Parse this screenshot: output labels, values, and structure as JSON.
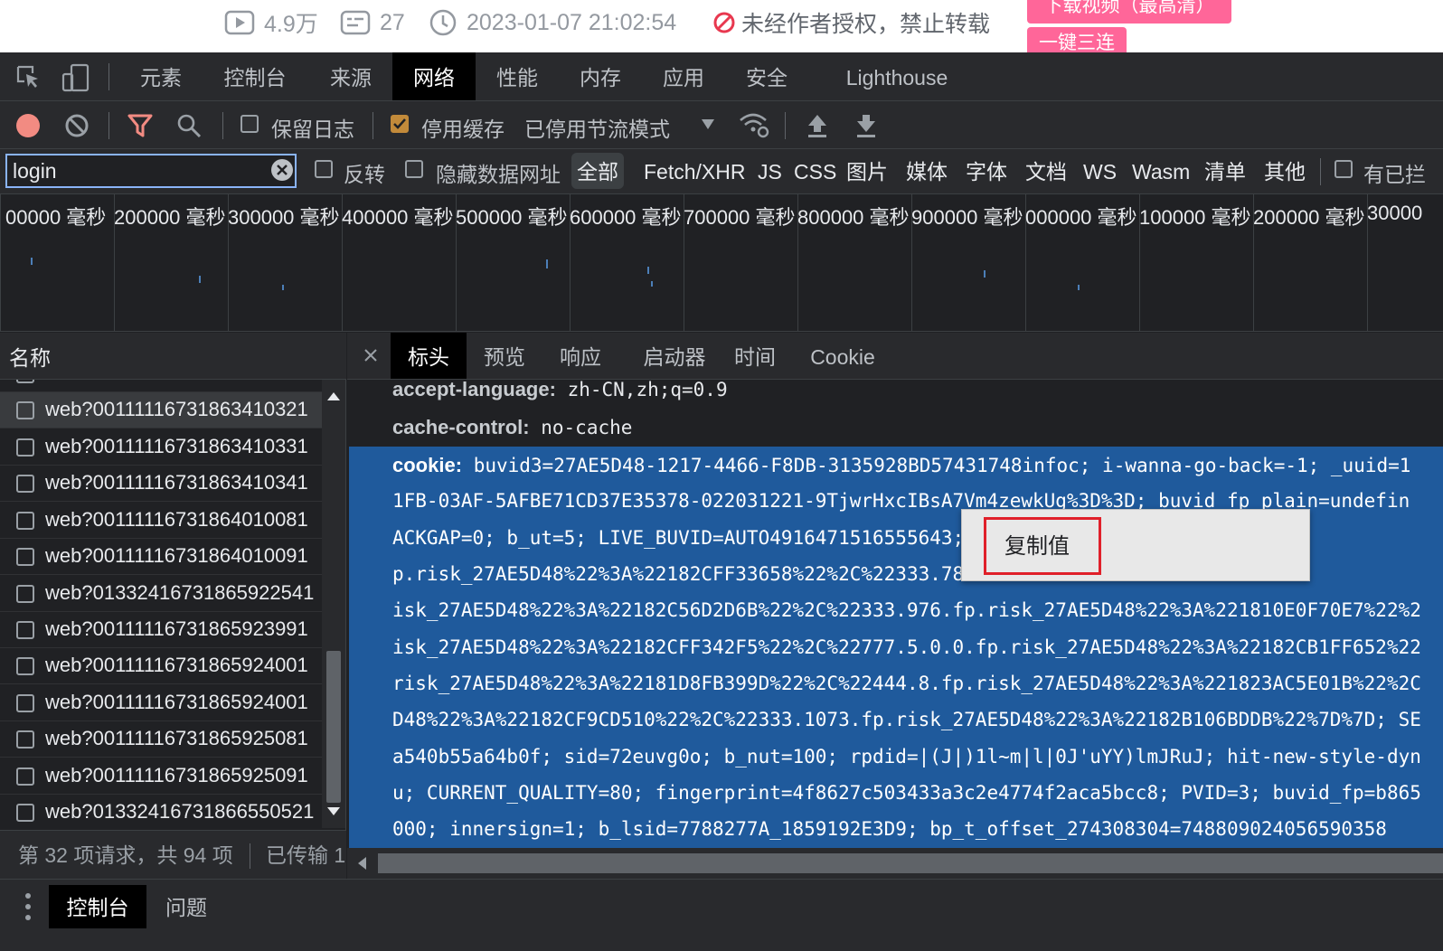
{
  "video_info": {
    "views": "4.9万",
    "danmaku": "27",
    "published": "2023-01-07 21:02:54",
    "notice": "未经作者授权，禁止转载",
    "download_label": "下载视频（最高清）",
    "triple_label": "一键三连"
  },
  "panel_tabs": [
    "元素",
    "控制台",
    "来源",
    "网络",
    "性能",
    "内存",
    "应用",
    "安全",
    "Lighthouse"
  ],
  "active_panel": "网络",
  "toolbar": {
    "preserve_log": "保留日志",
    "disable_cache": "停用缓存",
    "throttling": "已停用节流模式"
  },
  "filter": {
    "value": "login",
    "invert": "反转",
    "hide_data_urls": "隐藏数据网址",
    "types": [
      "全部",
      "Fetch/XHR",
      "JS",
      "CSS",
      "图片",
      "媒体",
      "字体",
      "文档",
      "WS",
      "Wasm",
      "清单",
      "其他"
    ],
    "blocked_cookies": "有已拦"
  },
  "timeline_ticks": [
    "00000 毫秒",
    "200000 毫秒",
    "300000 毫秒",
    "400000 毫秒",
    "500000 毫秒",
    "600000 毫秒",
    "700000 毫秒",
    "800000 毫秒",
    "900000 毫秒",
    "000000 毫秒",
    "100000 毫秒",
    "200000 毫秒",
    "30000"
  ],
  "request_list": {
    "header": "名称",
    "rows": [
      "web?00111116731863410321",
      "web?00111116731863410331",
      "web?00111116731863410341",
      "web?00111116731864010081",
      "web?00111116731864010091",
      "web?01332416731865922541",
      "web?00111116731865923991",
      "web?00111116731865924001",
      "web?00111116731865924001",
      "web?00111116731865925081",
      "web?00111116731865925091",
      "web?01332416731866550521"
    ],
    "status": "第 32 项请求，共 94 项",
    "transferred": "已传输 1"
  },
  "detail_tabs": [
    "标头",
    "预览",
    "响应",
    "启动器",
    "时间",
    "Cookie"
  ],
  "active_detail_tab": "标头",
  "headers": [
    {
      "key": "accept-language:",
      "value": "zh-CN,zh;q=0.9"
    },
    {
      "key": "cache-control:",
      "value": "no-cache"
    }
  ],
  "cookie": {
    "key": "cookie:",
    "lines": [
      "buvid3=27AE5D48-1217-4466-F8DB-3135928BD57431748infoc; i-wanna-go-back=-1; _uuid=1",
      "1FB-03AF-5AFBE71CD37E35378-022031221-9TjwrHxcIBsA7Vm4zewkUg%3D%3D; buvid_fp_plain=undefin",
      "ACKGAP=0; b_ut=5; LIVE_BUVID=AUTO4916471516555643;                                 =1; black",
      "p.risk_27AE5D48%22%3A%22182CFF33658%22%2C%22333.78                                 CFF3518B%2",
      "isk_27AE5D48%22%3A%22182C56D2D6B%22%2C%22333.976.fp.risk_27AE5D48%22%3A%221810E0F70E7%22%2",
      "isk_27AE5D48%22%3A%22182CFF342F5%22%2C%22777.5.0.0.fp.risk_27AE5D48%22%3A%22182CB1FF652%22",
      "risk_27AE5D48%22%3A%22181D8FB399D%22%2C%22444.8.fp.risk_27AE5D48%22%3A%221823AC5E01B%22%2C",
      "D48%22%3A%22182CF9CD510%22%2C%22333.1073.fp.risk_27AE5D48%22%3A%22182B106BDDB%22%7D%7D; SE",
      "a540b55a64b0f; sid=72euvg0o; b_nut=100; rpdid=|(J|)1l~m|l|0J'uYY)lmJRuJ; hit-new-style-dyn",
      "u; CURRENT_QUALITY=80; fingerprint=4f8627c503433a3c2e4774f2aca5bcc8; PVID=3; buvid_fp=b865",
      "000; innersign=1; b_lsid=7788277A_1859192E3D9; bp_t_offset_274308304=748809024056590358"
    ]
  },
  "context_menu": {
    "copy_value": "复制值"
  },
  "drawer_tabs": [
    "控制台",
    "问题"
  ],
  "colors": {
    "selection": "#1f5a9c",
    "accent_pink": "#ff6699",
    "record_red": "#f28b82",
    "highlight_border": "#e0202a"
  }
}
